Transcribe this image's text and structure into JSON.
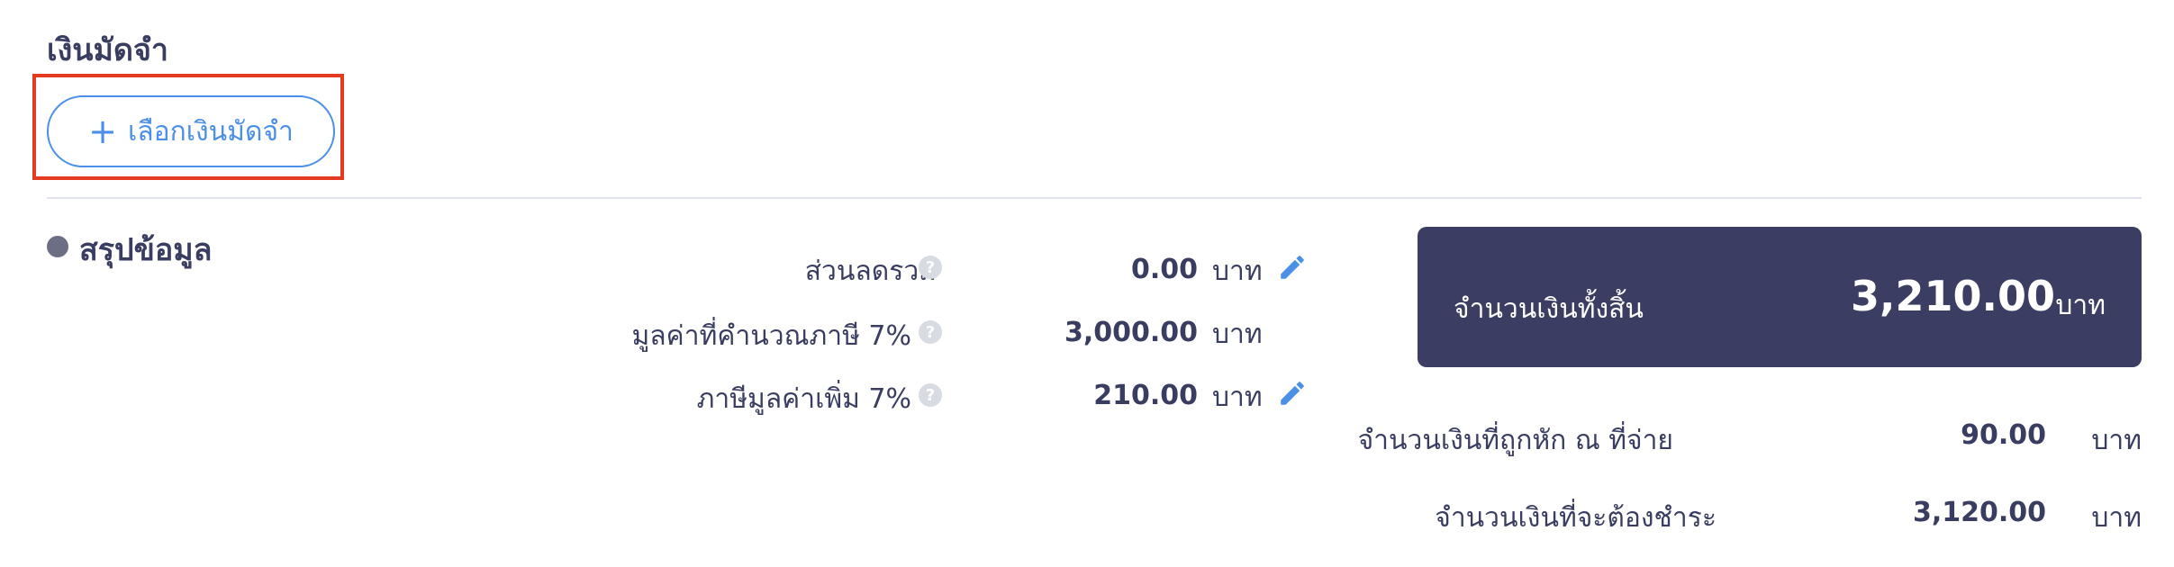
{
  "deposit": {
    "title": "เงินมัดจำ",
    "select_button_plus": "+",
    "select_button_label": "เลือกเงินมัดจำ"
  },
  "summary": {
    "title": "สรุปข้อมูล",
    "rows": [
      {
        "label": "ส่วนลดรวม",
        "help": "?",
        "value": "0.00",
        "unit": "บาท",
        "editable": true
      },
      {
        "label": "มูลค่าที่คำนวณภาษี 7%",
        "help": "?",
        "value": "3,000.00",
        "unit": "บาท",
        "editable": false
      },
      {
        "label": "ภาษีมูลค่าเพิ่ม 7%",
        "help": "?",
        "value": "210.00",
        "unit": "บาท",
        "editable": true
      }
    ],
    "total": {
      "label": "จำนวนเงินทั้งสิ้น",
      "value": "3,210.00",
      "unit": "บาท"
    },
    "withholding": {
      "label": "จำนวนเงินที่ถูกหัก ณ ที่จ่าย",
      "value": "90.00",
      "unit": "บาท"
    },
    "payable": {
      "label": "จำนวนเงินที่จะต้องชำระ",
      "value": "3,120.00",
      "unit": "บาท"
    }
  },
  "colors": {
    "accent": "#4a8fe8",
    "highlight": "#e23b22",
    "card": "#3b3d63",
    "text": "#3a3d62"
  },
  "icons": {
    "edit": "pencil-icon",
    "help": "question-circle-icon"
  }
}
